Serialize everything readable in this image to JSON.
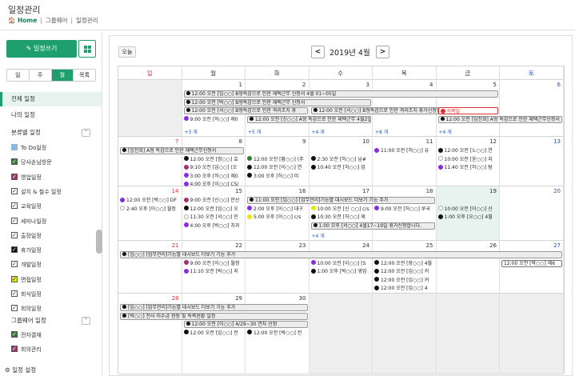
{
  "page": {
    "title": "일정관리"
  },
  "breadcrumb": {
    "home": "Home",
    "items": [
      "그룹웨어",
      "일정관리"
    ]
  },
  "sidebar": {
    "write_label": "일정쓰기",
    "views": [
      "일",
      "주",
      "월",
      "목록"
    ],
    "active_view": 2,
    "nav": [
      "전체 일정",
      "나의 일정"
    ],
    "cat_header": "분류별 일정",
    "categories": [
      {
        "label": "To Do일정",
        "color": "#8fb8e0",
        "checked": false
      },
      {
        "label": "당사손님방문",
        "color": "#2e7d32",
        "checked": true
      },
      {
        "label": "영업일정",
        "color": "#a03070",
        "checked": true
      },
      {
        "label": "설치 & 철수 일정",
        "color": "#ffffff",
        "checked": true
      },
      {
        "label": "교육일정",
        "color": "#ffffff",
        "checked": true
      },
      {
        "label": "세미나일정",
        "color": "#ffffff",
        "checked": true
      },
      {
        "label": "출장일정",
        "color": "#ffffff",
        "checked": true
      },
      {
        "label": "휴가일정",
        "color": "#111111",
        "checked": true
      },
      {
        "label": "개발일정",
        "color": "#ffffff",
        "checked": true
      },
      {
        "label": "면접일정",
        "color": "#e8e800",
        "checked": true
      },
      {
        "label": "회식일정",
        "color": "#ffffff",
        "checked": true
      },
      {
        "label": "회의일정",
        "color": "#ffffff",
        "checked": true
      }
    ],
    "gw_header": "그룹웨어 일정",
    "gw_items": [
      {
        "label": "전자결재",
        "color": "#2e7d32",
        "checked": true
      },
      {
        "label": "회의관리",
        "color": "#a03070",
        "checked": true
      }
    ],
    "settings_label": "일정 설정"
  },
  "calendar": {
    "today_label": "오늘",
    "month_title": "2019년 4월",
    "prev": "<",
    "next": ">",
    "dow": [
      "일",
      "월",
      "화",
      "수",
      "목",
      "금",
      "토"
    ],
    "weeks": [
      [
        {
          "d": "",
          "dim": true
        },
        {
          "d": "1"
        },
        {
          "d": "2"
        },
        {
          "d": "3"
        },
        {
          "d": "4"
        },
        {
          "d": "5"
        },
        {
          "d": "6"
        }
      ],
      [
        {
          "d": "7"
        },
        {
          "d": "8"
        },
        {
          "d": "9"
        },
        {
          "d": "10"
        },
        {
          "d": "11"
        },
        {
          "d": "12"
        },
        {
          "d": "13"
        }
      ],
      [
        {
          "d": "14"
        },
        {
          "d": "15"
        },
        {
          "d": "16"
        },
        {
          "d": "17"
        },
        {
          "d": "18"
        },
        {
          "d": "19",
          "today": true
        },
        {
          "d": "20"
        }
      ],
      [
        {
          "d": "21"
        },
        {
          "d": "22"
        },
        {
          "d": "23"
        },
        {
          "d": "24"
        },
        {
          "d": "25"
        },
        {
          "d": "26"
        },
        {
          "d": "27"
        }
      ],
      [
        {
          "d": "28"
        },
        {
          "d": "29"
        },
        {
          "d": "30"
        },
        {
          "d": "",
          "dim": true
        },
        {
          "d": "",
          "dim": true
        },
        {
          "d": "",
          "dim": true
        },
        {
          "d": "",
          "dim": true
        }
      ]
    ],
    "bars": [
      {
        "w": 0,
        "c": 1,
        "span": 5,
        "row": 0,
        "text": "12:00 오전 [임○○] B형독감으로 인한 재택근무 신청서 4월 01~05일"
      },
      {
        "w": 0,
        "c": 1,
        "span": 3,
        "row": 1,
        "text": "12:00 오전 [박○○] B형독감으로 인한 재택근무 신청서"
      },
      {
        "w": 0,
        "c": 1,
        "span": 2,
        "row": 2,
        "text": "12:00 오전 [서○○] B형독감으로 인한 격리조치 휴"
      },
      {
        "w": 0,
        "c": 3,
        "span": 3,
        "row": 2,
        "text": "12:00 오전 [서○○] B형독감으로 인한 격리조치 휴가신청합니다 (2)"
      },
      {
        "w": 0,
        "c": 2,
        "span": 2,
        "row": 3,
        "text": "12:00 오전 [신○○] A형 독감으로 인한 재택근무 4월2일 ~ 3일"
      },
      {
        "w": 0,
        "c": 5,
        "span": 2,
        "row": 3,
        "text": "12:00 오전 [임진희] A형 독감으로 인한 재택근무신청서"
      },
      {
        "w": 1,
        "c": 0,
        "span": 2,
        "row": 0,
        "text": "[임진희] A형 독감으로 인한 재택근무신청서"
      },
      {
        "w": 2,
        "c": 2,
        "span": 3,
        "row": 0,
        "text": "11:00 오전 [임○○] [업무관리]기능별 대시보드 더보기 기능 추가"
      },
      {
        "w": 2,
        "c": 3,
        "span": 2,
        "row": 3,
        "text": "1:00 오후 [서○○] 4월17~19일 휴가신청합니다."
      },
      {
        "w": 3,
        "c": 0,
        "span": 7,
        "row": 0,
        "text": "[임○○] [업무관리]기능별 대시보드 더보기 기능 추가"
      },
      {
        "w": 4,
        "c": 0,
        "span": 3,
        "row": 0,
        "text": "[임○○] [업무관리]기능별 대시보드 더보기 기능 추가"
      },
      {
        "w": 4,
        "c": 0,
        "span": 3,
        "row": 1,
        "text": "[박○○] 전사 미수금 현장 및 독촉현황 일정"
      },
      {
        "w": 4,
        "c": 1,
        "span": 2,
        "row": 2,
        "text": "12:00 오전 [이○○] 4/29~30 연차 신청"
      }
    ],
    "events": [
      {
        "w": 0,
        "c": 5,
        "row": 2,
        "dot": "#e03030",
        "text": "식목일",
        "red": true
      },
      {
        "w": 0,
        "c": 1,
        "row": 3,
        "dot": "#8a2be2",
        "text": "9:00 오전 [허○○] 제0"
      },
      {
        "w": 1,
        "c": 1,
        "row": 1,
        "dot": "#111",
        "text": "12:00 오전 [정○○] 효"
      },
      {
        "w": 1,
        "c": 1,
        "row": 2,
        "dot": "#a03070",
        "text": "9:10 오전 [임○○] (오"
      },
      {
        "w": 1,
        "c": 1,
        "row": 3,
        "dot": "#8a2be2",
        "text": "3:00 오후 [허○○] 제0"
      },
      {
        "w": 1,
        "c": 1,
        "row": 4,
        "dot": "#8a2be2",
        "text": "4:00 오후 [이○○] CS/"
      },
      {
        "w": 1,
        "c": 2,
        "row": 1,
        "dot": "#2e7d32",
        "text": "12:00 오전 [황○○] (주"
      },
      {
        "w": 1,
        "c": 2,
        "row": 2,
        "dot": "#111",
        "text": "12:00 오전 [이○○] 연"
      },
      {
        "w": 1,
        "c": 2,
        "row": 3,
        "dot": "#111",
        "text": "3:00 오후 [허○○] 미"
      },
      {
        "w": 1,
        "c": 3,
        "row": 1,
        "dot": "#111",
        "text": "2:30 오전 [허○○] 남#"
      },
      {
        "w": 1,
        "c": 3,
        "row": 2,
        "dot": "#111",
        "text": "10:40 오전 [허○○] 업"
      },
      {
        "w": 1,
        "c": 4,
        "row": 0,
        "dot": "#8a2be2",
        "text": "11:00 오전 [허○○] 유"
      },
      {
        "w": 1,
        "c": 5,
        "row": 0,
        "dot": "#111",
        "text": "12:00 오전 [노○○] 연"
      },
      {
        "w": 1,
        "c": 5,
        "row": 1,
        "dot": "#fff",
        "text": "10:00 오전 [윤○○] 지"
      },
      {
        "w": 1,
        "c": 5,
        "row": 2,
        "dot": "#8a2be2",
        "text": "11:40 오전 [허○○] 탐"
      },
      {
        "w": 2,
        "c": 0,
        "row": 0,
        "dot": "#8a2be2",
        "text": "12:00 오전 [박○○] DF"
      },
      {
        "w": 2,
        "c": 0,
        "row": 1,
        "dot": "#fff",
        "text": "2:40 오후 [이○○] 월정"
      },
      {
        "w": 2,
        "c": 1,
        "row": 0,
        "dot": "#a03070",
        "text": "9:00 오전 [신○○] 안산"
      },
      {
        "w": 2,
        "c": 1,
        "row": 1,
        "dot": "#111",
        "text": "12:00 오전 [임○○] 오"
      },
      {
        "w": 2,
        "c": 1,
        "row": 2,
        "dot": "#fff",
        "text": "11:30 오전 [서○○] 민"
      },
      {
        "w": 2,
        "c": 1,
        "row": 3,
        "dot": "#8a2be2",
        "text": "4:00 오후 [박○○] 치과"
      },
      {
        "w": 2,
        "c": 2,
        "row": 1,
        "dot": "#8a2be2",
        "text": "2:00 오후 [이○○] 대구"
      },
      {
        "w": 2,
        "c": 2,
        "row": 2,
        "dot": "#e8e800",
        "text": "5:00 오후 [이○○] c/s"
      },
      {
        "w": 2,
        "c": 3,
        "row": 1,
        "dot": "#e8e800",
        "text": "10:00 오전 [신 ○○] c/s"
      },
      {
        "w": 2,
        "c": 3,
        "row": 2,
        "dot": "#111",
        "text": "10:30 오전 [허○○] 제"
      },
      {
        "w": 2,
        "c": 4,
        "row": 1,
        "dot": "#8a2be2",
        "text": "9:00 오전 [허○○] 루국"
      },
      {
        "w": 2,
        "c": 5,
        "row": 1,
        "dot": "#fff",
        "text": "10:00 오전 [이○○] 신"
      },
      {
        "w": 2,
        "c": 5,
        "row": 2,
        "dot": "#111",
        "text": "1:00 오후 [오○○] 4월"
      },
      {
        "w": 3,
        "c": 1,
        "row": 1,
        "dot": "#a03070",
        "text": "9:00 오전 [이○○] 월정"
      },
      {
        "w": 3,
        "c": 1,
        "row": 2,
        "dot": "#8a2be2",
        "text": "11:10 오전 [박○○] 지"
      },
      {
        "w": 3,
        "c": 3,
        "row": 1,
        "dot": "#8a2be2",
        "text": "10:00 오전 [이○○] [S"
      },
      {
        "w": 3,
        "c": 3,
        "row": 2,
        "dot": "#111",
        "text": "1:00 오후 [박○○] 영업"
      },
      {
        "w": 3,
        "c": 4,
        "row": 1,
        "dot": "#111",
        "text": "12:00 오전 [장○○] 4월"
      },
      {
        "w": 3,
        "c": 4,
        "row": 2,
        "dot": "#111",
        "text": "12:00 오전 [임○○] 커"
      },
      {
        "w": 3,
        "c": 4,
        "row": 3,
        "dot": "#111",
        "text": "12:00 오전 [임○○] 커"
      },
      {
        "w": 3,
        "c": 4,
        "row": 4,
        "dot": "#111",
        "text": "12:00 오전 [임○○] 4"
      },
      {
        "w": 4,
        "c": 1,
        "row": 3,
        "dot": "#111",
        "text": "12:00 오전 [임○○] 전"
      },
      {
        "w": 4,
        "c": 2,
        "row": 3,
        "dot": "#111",
        "text": "12:00 오전 [박○○] 전"
      }
    ],
    "boxes": [
      {
        "w": 3,
        "c": 6,
        "row": 1,
        "text": "12:00 오전 [박○○] 제6"
      }
    ],
    "more": [
      {
        "w": 0,
        "c": 1,
        "text": "+3 개"
      },
      {
        "w": 0,
        "c": 2,
        "text": "+5 개"
      },
      {
        "w": 0,
        "c": 3,
        "text": "+4 개"
      },
      {
        "w": 0,
        "c": 4,
        "text": "+8 개"
      },
      {
        "w": 0,
        "c": 5,
        "text": "+4 개"
      },
      {
        "w": 2,
        "c": 3,
        "text": "+4 개"
      }
    ]
  }
}
